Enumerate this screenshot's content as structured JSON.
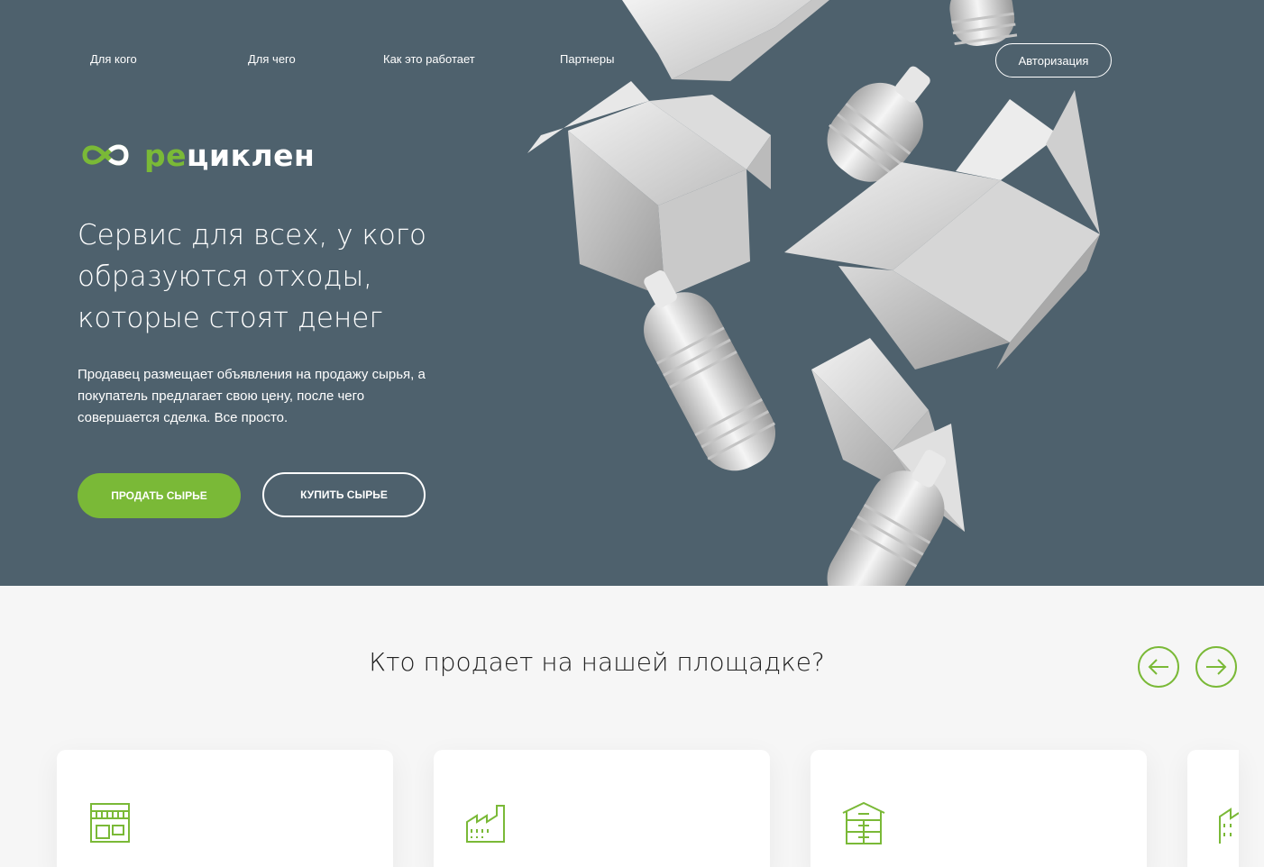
{
  "nav": {
    "items": [
      {
        "label": "Для кого"
      },
      {
        "label": "Для чего"
      },
      {
        "label": "Как это работает"
      },
      {
        "label": "Партнеры"
      }
    ],
    "auth_label": "Авторизация"
  },
  "logo": {
    "accent": "ре",
    "rest": "циклен"
  },
  "hero": {
    "title": "Сервис для всех, у кого образуются отходы, которые стоят денег",
    "description": "Продавец размещает объявления на продажу сырья, а покупатель предлагает свою цену, после чего совершается сделка. Все просто.",
    "sell_label": "ПРОДАТЬ СЫРЬЕ",
    "buy_label": "КУПИТЬ СЫРЬЕ"
  },
  "sellers": {
    "title": "Кто продает на нашей площадке?",
    "cards": [
      {
        "icon": "store-icon"
      },
      {
        "icon": "factory-icon"
      },
      {
        "icon": "warehouse-icon"
      },
      {
        "icon": "building-icon"
      }
    ]
  },
  "colors": {
    "hero_bg": "#4e616d",
    "accent": "#7ab937",
    "page_bg": "#f6f6f6"
  }
}
